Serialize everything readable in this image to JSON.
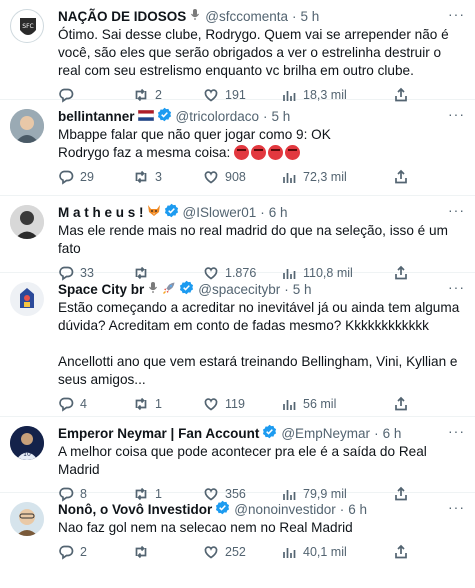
{
  "tweets": [
    {
      "name": "NAÇÃO DE IDOSOS",
      "handle": "@sfccomenta",
      "time": "5 h",
      "text": "Ótimo. Sai desse clube, Rodrygo. Quem vai se arrepender não é você, são eles que serão obrigados a ver o estrelinha destruir o real com seu estrelismo enquanto vc brilha em outro clube.",
      "replies": "",
      "retweets": "2",
      "likes": "191",
      "views": "18,3 mil",
      "badges": [
        "microphone-icon"
      ]
    },
    {
      "name": "bellintanner",
      "handle": "@tricolordaco",
      "time": "5 h",
      "text": "Mbappe falar que não quer jogar como 9: OK\nRodrygo faz a mesma coisa: ",
      "replies": "29",
      "retweets": "3",
      "likes": "908",
      "views": "72,3 mil",
      "badges": [
        "netherlands-flag-icon",
        "verified-badge-icon"
      ]
    },
    {
      "name": "M a t h e u s !",
      "handle": "@ISlower01",
      "time": "6 h",
      "text": "Mas ele rende mais no real madrid do que na seleção, isso é um fato",
      "replies": "33",
      "retweets": "",
      "likes": "1.876",
      "views": "110,8 mil",
      "badges": [
        "fox-emoji-icon",
        "verified-badge-icon"
      ]
    },
    {
      "name": "Space City br",
      "handle": "@spacecitybr",
      "time": "5 h",
      "text": "Estão começando a acreditar no inevitável já ou ainda tem alguma dúvida? Acreditam em conto de fadas mesmo? Kkkkkkkkkkkk\n\nAncellotti ano que vem estará treinando Bellingham, Vini, Kyllian e seus amigos...",
      "replies": "4",
      "retweets": "1",
      "likes": "119",
      "views": "56 mil",
      "badges": [
        "microphone-icon",
        "rocket-icon",
        "verified-badge-icon"
      ]
    },
    {
      "name": "Emperor Neymar | Fan Account",
      "handle": "@EmpNeymar",
      "time": "6 h",
      "text": "A melhor coisa que pode acontecer pra ele é a saída do Real Madrid",
      "replies": "8",
      "retweets": "1",
      "likes": "356",
      "views": "79,9 mil",
      "badges": [
        "verified-badge-icon"
      ]
    },
    {
      "name": "Nonô, o Vovô Investidor",
      "handle": "@nonoinvestidor",
      "time": "6 h",
      "text": "Nao faz gol nem na selecao nem no Real Madrid",
      "replies": "2",
      "retweets": "",
      "likes": "252",
      "views": "40,1 mil",
      "badges": [
        "verified-badge-icon"
      ]
    }
  ],
  "colors": {
    "verified": "#1d9bf0",
    "secondary_text": "#536471",
    "divider": "#eff3f4"
  }
}
